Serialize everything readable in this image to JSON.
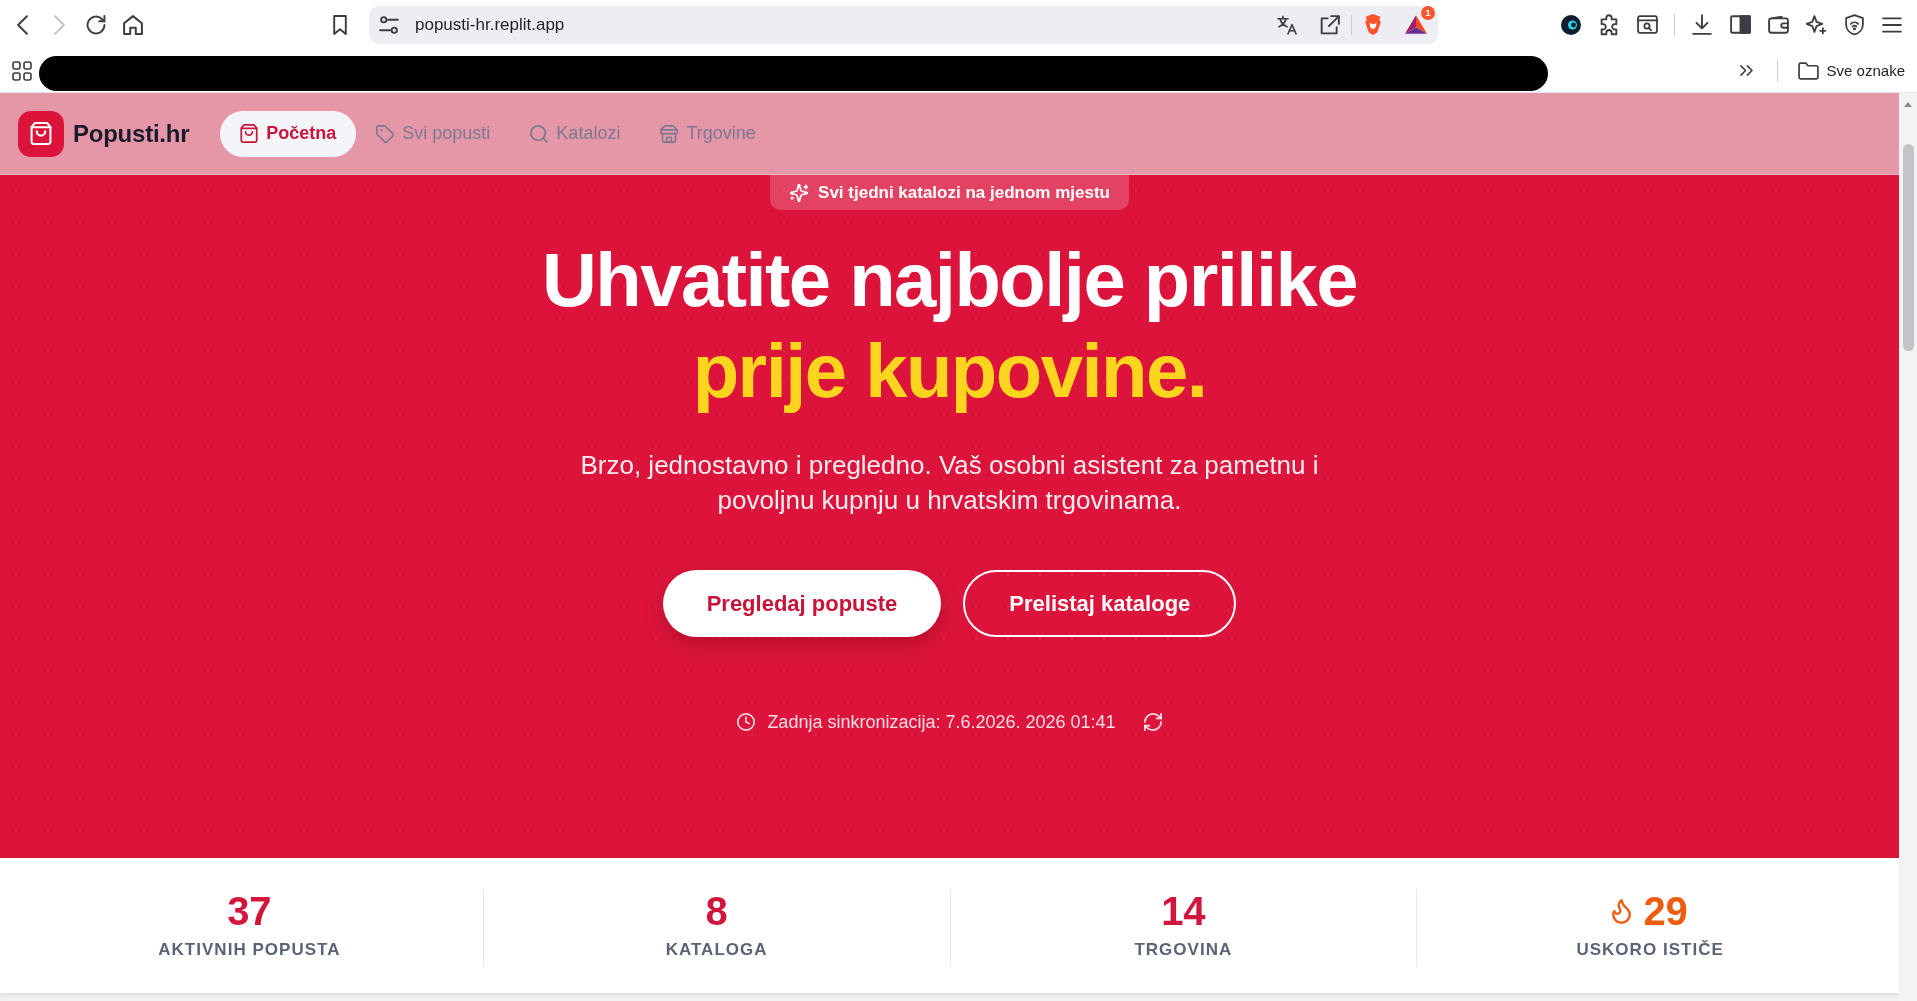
{
  "browser": {
    "controls": [
      {
        "disabled": false
      },
      {
        "disabled": true
      },
      {
        "disabled": false
      },
      {
        "disabled": false
      }
    ],
    "address": "popusti-hr.replit.app",
    "rewards_count": "1",
    "bookmarks_folder": "Sve oznake"
  },
  "site": {
    "logo": "Popusti.hr",
    "nav": [
      {
        "label": "Početna",
        "selected": true
      },
      {
        "label": "Svi popusti",
        "selected": false
      },
      {
        "label": "Katalozi",
        "selected": false
      },
      {
        "label": "Trgovine",
        "selected": false
      }
    ]
  },
  "hero": {
    "badge": "Svi tjedni katalozi na jednom mjestu",
    "headline": "Uhvatite najbolje prilike",
    "headline_highlight": "prije kupovine.",
    "subtitle": "Brzo, jednostavno i pregledno. Vaš osobni asistent za pametnu i povoljnu kupnju u hrvatskim trgovinama.",
    "buttons": [
      {
        "label": "Pregledaj popuste",
        "kind": "primary"
      },
      {
        "label": "Prelistaj kataloge",
        "kind": "outline"
      }
    ],
    "sync": "Zadnja sinkronizacija: 7.6.2026. 2026 01:41"
  },
  "stats": [
    {
      "value": "37",
      "label": "AKTIVNIH POPUSTA",
      "kind": "count"
    },
    {
      "value": "8",
      "label": "KATALOGA",
      "kind": "count"
    },
    {
      "value": "14",
      "label": "TRGOVINA",
      "kind": "count"
    },
    {
      "value": "29",
      "label": "USKORO ISTIČE",
      "kind": "warning"
    }
  ]
}
